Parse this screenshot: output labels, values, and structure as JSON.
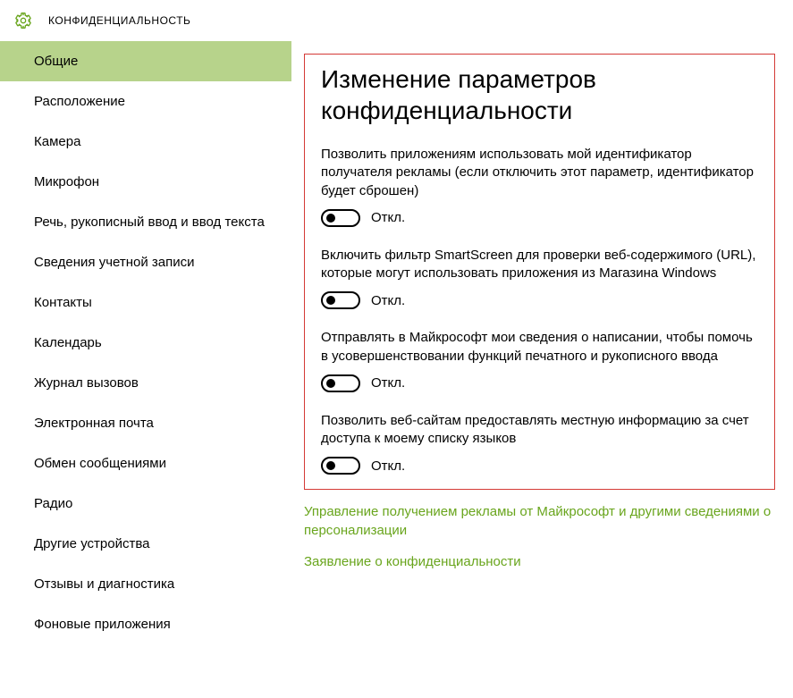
{
  "header": {
    "title": "КОНФИДЕНЦИАЛЬНОСТЬ"
  },
  "sidebar": {
    "items": [
      {
        "label": "Общие",
        "selected": true
      },
      {
        "label": "Расположение",
        "selected": false
      },
      {
        "label": "Камера",
        "selected": false
      },
      {
        "label": "Микрофон",
        "selected": false
      },
      {
        "label": "Речь, рукописный ввод и ввод текста",
        "selected": false
      },
      {
        "label": "Сведения учетной записи",
        "selected": false
      },
      {
        "label": "Контакты",
        "selected": false
      },
      {
        "label": "Календарь",
        "selected": false
      },
      {
        "label": "Журнал вызовов",
        "selected": false
      },
      {
        "label": "Электронная почта",
        "selected": false
      },
      {
        "label": "Обмен сообщениями",
        "selected": false
      },
      {
        "label": "Радио",
        "selected": false
      },
      {
        "label": "Другие устройства",
        "selected": false
      },
      {
        "label": "Отзывы и диагностика",
        "selected": false
      },
      {
        "label": "Фоновые приложения",
        "selected": false
      }
    ]
  },
  "main": {
    "section_title": "Изменение параметров конфиденциальности",
    "settings": [
      {
        "desc": "Позволить приложениям использовать мой идентификатор получателя рекламы (если отключить этот параметр, идентификатор будет сброшен)",
        "state_label": "Откл.",
        "on": false
      },
      {
        "desc": "Включить фильтр SmartScreen для проверки веб-содержимого (URL), которые могут использовать приложения из Магазина Windows",
        "state_label": "Откл.",
        "on": false
      },
      {
        "desc": "Отправлять в Майкрософт мои сведения о написании, чтобы помочь в усовершенствовании функций печатного и рукописного ввода",
        "state_label": "Откл.",
        "on": false
      },
      {
        "desc": "Позволить веб-сайтам предоставлять местную информацию за счет доступа к моему списку языков",
        "state_label": "Откл.",
        "on": false
      }
    ],
    "links": [
      "Управление получением рекламы от Майкрософт и другими сведениями о персонализации",
      "Заявление о конфиденциальности"
    ]
  }
}
